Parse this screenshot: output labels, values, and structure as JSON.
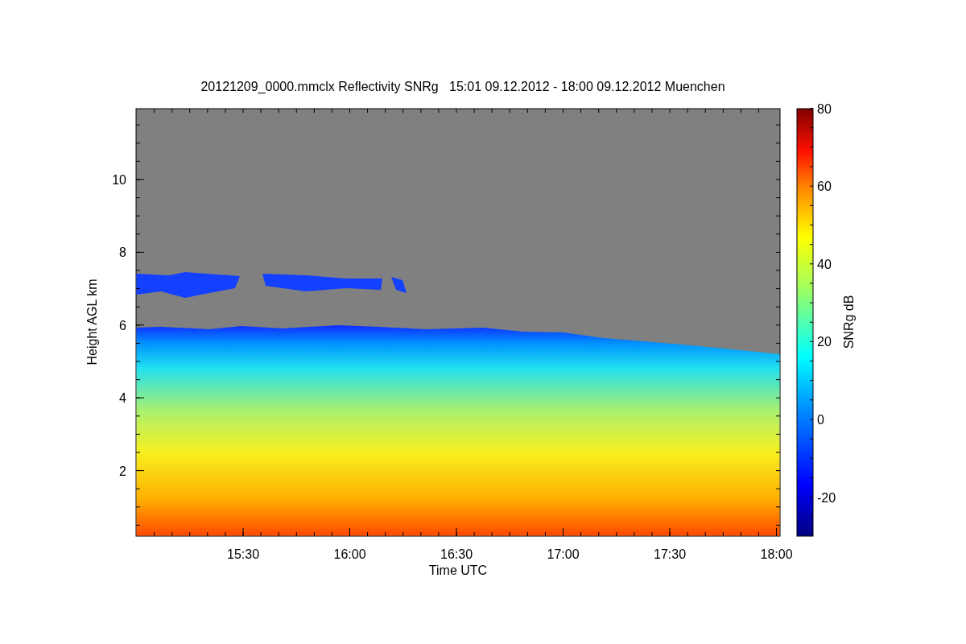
{
  "title": "20121209_0000.mmclx Reflectivity SNRg   15:01 09.12.2012 - 18:00 09.12.2012 Muenchen",
  "y_axis": {
    "label": "Height AGL km",
    "ticks": [
      "10",
      "8",
      "6",
      "4",
      "2"
    ]
  },
  "x_axis": {
    "label": "Time UTC",
    "ticks": [
      "15:30",
      "16:00",
      "16:30",
      "17:00",
      "17:30",
      "18:00"
    ]
  },
  "colorbar": {
    "label": "SNRg dB",
    "ticks": [
      "80",
      "60",
      "40",
      "20",
      "0",
      "-20"
    ]
  }
}
